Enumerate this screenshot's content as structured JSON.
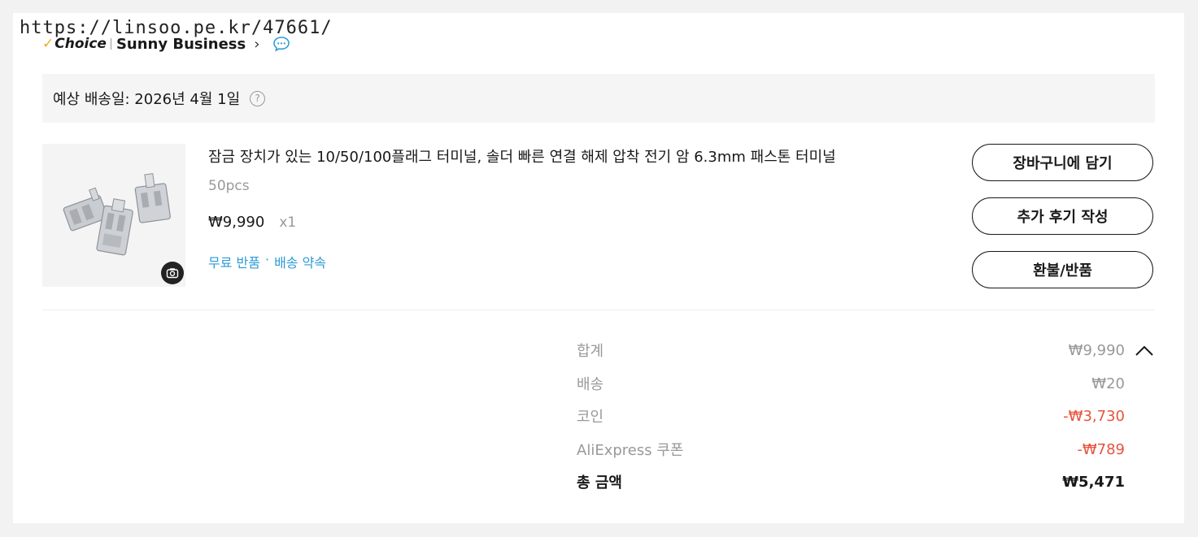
{
  "watermark": "https://linsoo.pe.kr/47661/",
  "store": {
    "badge": "Choice",
    "name": "Sunny Business"
  },
  "delivery": {
    "text": "예상 배송일: 2026년 4월 1일"
  },
  "product": {
    "title": "잠금 장치가 있는 10/50/100플래그 터미널, 솔더 빠른 연결 해제 압착 전기 암 6.3mm 패스톤 터미널",
    "variant": "50pcs",
    "price": "₩9,990",
    "quantity": "x1",
    "tags": [
      "무료 반품",
      "배송 약속"
    ],
    "tag_separator": "·"
  },
  "actions": {
    "add_to_cart": "장바구니에 담기",
    "write_review": "추가 후기 작성",
    "refund": "환불/반품"
  },
  "summary": {
    "subtotal_label": "합계",
    "subtotal_value": "₩9,990",
    "shipping_label": "배송",
    "shipping_value": "₩20",
    "coins_label": "코인",
    "coins_value": "-₩3,730",
    "coupon_label": "AliExpress 쿠폰",
    "coupon_value": "-₩789",
    "total_label": "총 금액",
    "total_value": "₩5,471"
  },
  "colors": {
    "accent_blue": "#2e9bd6",
    "discount_red": "#e8533f",
    "choice_check": "#f5a623"
  }
}
